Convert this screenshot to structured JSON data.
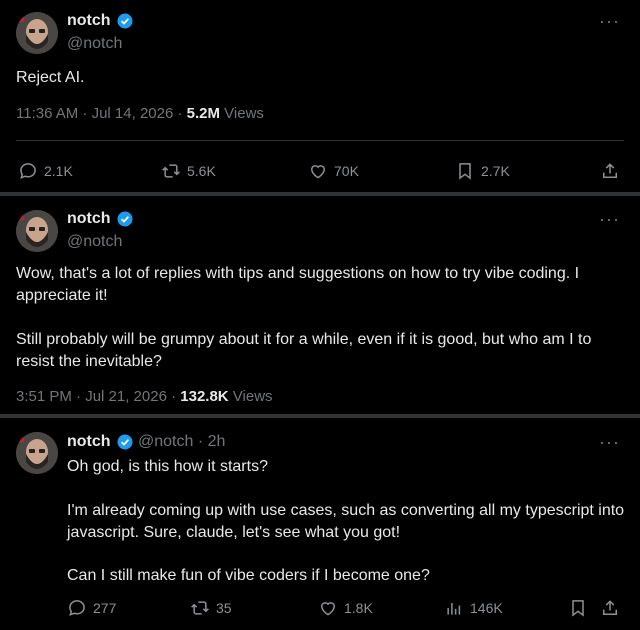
{
  "posts": [
    {
      "name": "notch",
      "handle": "@notch",
      "text": "Reject AI.",
      "time": "11:36 AM · Jul 14, 2026 · ",
      "views_count": "5.2M",
      "views_label": " Views",
      "replies": "2.1K",
      "reposts": "5.6K",
      "likes": "70K",
      "bookmarks": "2.7K"
    },
    {
      "name": "notch",
      "handle": "@notch",
      "text_1": "Wow, that's a lot of replies with tips and suggestions on how to try vibe coding. I appreciate it!",
      "text_2": "Still probably will be grumpy about it for a while, even if it is good, but who am I to resist the inevitable?",
      "time": "3:51 PM · Jul 21, 2026 · ",
      "views_count": "132.8K",
      "views_label": " Views"
    },
    {
      "name": "notch",
      "handle_time": "@notch · 2h",
      "text_1": "Oh god, is this how it starts?",
      "text_2": "I'm already coming up with use cases, such as converting all my typescript into javascript. Sure, claude, let's see what you got!",
      "text_3": "Can I still make fun of vibe coders if I become one?",
      "replies": "277",
      "reposts": "35",
      "likes": "1.8K",
      "views": "146K"
    }
  ],
  "more_glyph": "···",
  "colors": {
    "background": "#000000",
    "text": "#e7e9ea",
    "muted": "#71767b",
    "verified": "#1d9bf0",
    "divider": "#2f3336"
  }
}
